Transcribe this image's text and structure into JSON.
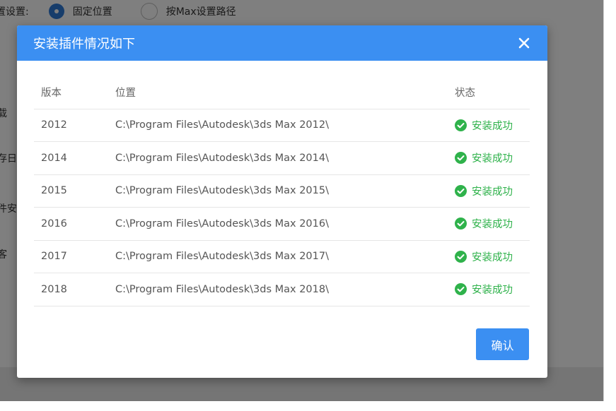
{
  "background": {
    "setting_label": "置设置:",
    "option_fixed": "固定位置",
    "option_max": "按Max设置路径",
    "side_labels": [
      "载",
      "存日",
      "件安",
      "客"
    ]
  },
  "dialog": {
    "title": "安装插件情况如下",
    "close_icon": "close-icon",
    "confirm_label": "确认",
    "columns": {
      "version": "版本",
      "path": "位置",
      "status": "状态"
    },
    "rows": [
      {
        "version": "2012",
        "path": "C:\\Program Files\\Autodesk\\3ds Max 2012\\",
        "status": "安装成功"
      },
      {
        "version": "2014",
        "path": "C:\\Program Files\\Autodesk\\3ds Max 2014\\",
        "status": "安装成功"
      },
      {
        "version": "2015",
        "path": "C:\\Program Files\\Autodesk\\3ds Max 2015\\",
        "status": "安装成功"
      },
      {
        "version": "2016",
        "path": "C:\\Program Files\\Autodesk\\3ds Max 2016\\",
        "status": "安装成功"
      },
      {
        "version": "2017",
        "path": "C:\\Program Files\\Autodesk\\3ds Max 2017\\",
        "status": "安装成功"
      },
      {
        "version": "2018",
        "path": "C:\\Program Files\\Autodesk\\3ds Max 2018\\",
        "status": "安装成功"
      }
    ]
  },
  "colors": {
    "accent": "#3b8ff2",
    "success": "#2fb24b"
  }
}
